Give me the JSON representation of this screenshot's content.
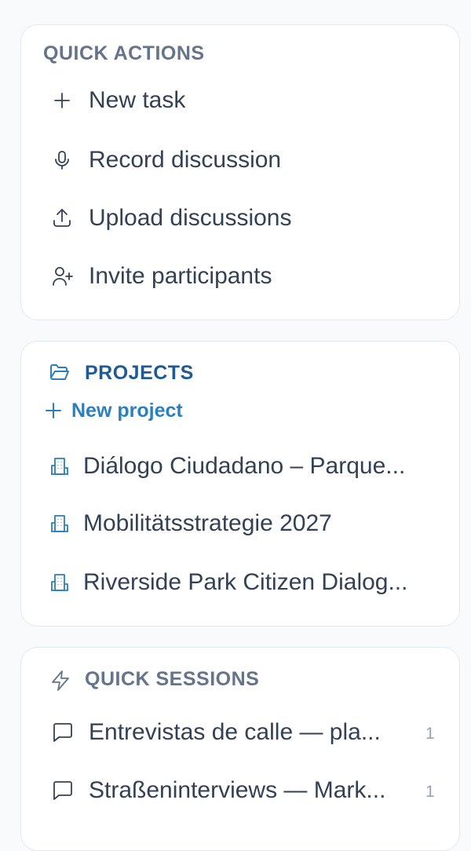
{
  "quick_actions": {
    "title": "QUICK ACTIONS",
    "items": [
      {
        "label": "New task",
        "icon": "plus-icon"
      },
      {
        "label": "Record discussion",
        "icon": "microphone-icon"
      },
      {
        "label": "Upload discussions",
        "icon": "upload-icon"
      },
      {
        "label": "Invite participants",
        "icon": "user-plus-icon"
      }
    ]
  },
  "projects": {
    "title": "PROJECTS",
    "title_icon": "folder-open-icon",
    "new_project_label": "New project",
    "items": [
      {
        "label": "Diálogo Ciudadano – Parque...",
        "icon": "building-icon"
      },
      {
        "label": "Mobilitätsstrategie 2027",
        "icon": "building-icon"
      },
      {
        "label": "Riverside Park Citizen Dialog...",
        "icon": "building-icon"
      }
    ]
  },
  "quick_sessions": {
    "title": "QUICK SESSIONS",
    "title_icon": "lightning-icon",
    "items": [
      {
        "label": "Entrevistas de calle — pla...",
        "count": "1",
        "icon": "chat-icon"
      },
      {
        "label": "Straßeninterviews — Mark...",
        "count": "1",
        "icon": "chat-icon"
      }
    ]
  },
  "colors": {
    "section_title_gray": "#64748b",
    "section_title_blue": "#1e5a96",
    "link_blue": "#2a7fc0",
    "text": "#334155",
    "border": "#e2e8f0"
  }
}
